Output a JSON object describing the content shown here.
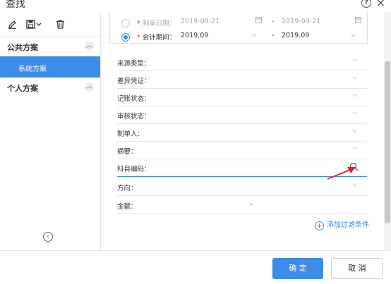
{
  "dialog": {
    "title": "查找",
    "help_glyph": "?",
    "close_glyph": "×"
  },
  "sidebar": {
    "public_group": "公共方案",
    "public_items": [
      "系统方案"
    ],
    "personal_group": "个人方案"
  },
  "date_filters": {
    "doc_date": {
      "label": "制单日期：",
      "from": "2019-09-21",
      "to": "2019-09-21",
      "selected": false
    },
    "period": {
      "label": "会计期间：",
      "from": "2019.09",
      "to": "2019.09",
      "selected": true
    },
    "dash": "-"
  },
  "filters": [
    {
      "label": "来源类型："
    },
    {
      "label": "差异凭证："
    },
    {
      "label": "记账状态："
    },
    {
      "label": "审核状态："
    },
    {
      "label": "制单人："
    },
    {
      "label": "摘要："
    },
    {
      "label": "科目编码："
    },
    {
      "label": "方向："
    },
    {
      "label": "金额：",
      "dash": "-"
    }
  ],
  "add_filter": "添加过滤条件",
  "buttons": {
    "confirm": "确 定",
    "cancel": "取 消"
  },
  "colors": {
    "accent": "#3c8ce8",
    "required": "#e83333",
    "annotation_arrow": "#e02020"
  }
}
